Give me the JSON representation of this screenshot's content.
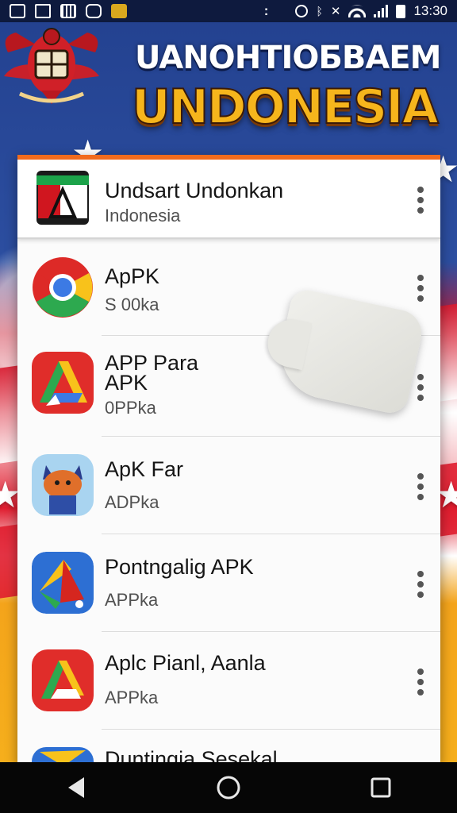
{
  "status_bar": {
    "left_icons": [
      "gallery-icon",
      "notification-icon",
      "grid-icon",
      "cast-icon",
      "app-icon"
    ],
    "center": ":",
    "right_icons": [
      "alarm-icon",
      "bluetooth-icon",
      "mute-icon",
      "wifi-icon",
      "signal-icon",
      "battery-icon"
    ],
    "time": "13:30"
  },
  "header": {
    "line1": "UANOHTIOБBAEM",
    "line2": "UNDONESIA",
    "line2_color": "#f6b51c"
  },
  "list": {
    "accent_color": "#f26b1d",
    "items": [
      {
        "title": "Undsart Undonkan",
        "subtitle": "Indonesia",
        "icon": "flag-app-icon"
      },
      {
        "title": "ApPK",
        "subtitle": "S 00ka",
        "icon": "chrome-style-icon"
      },
      {
        "title": "APP Para\nAPK",
        "subtitle": "0PPka",
        "icon": "drive-style-icon"
      },
      {
        "title": "ApK Far",
        "subtitle": "ADPka",
        "icon": "fox-character-icon"
      },
      {
        "title": "Pontngalig APK",
        "subtitle": "APPka",
        "icon": "paper-plane-icon"
      },
      {
        "title": "Aplc Pianl, Aanla",
        "subtitle": "APPka",
        "icon": "drive-red-icon"
      },
      {
        "title": "Duntingia Sesekal",
        "subtitle": "",
        "icon": "blue-app-icon"
      }
    ]
  },
  "nav_bar": {
    "buttons": [
      "back-icon",
      "home-icon",
      "recents-icon"
    ]
  }
}
